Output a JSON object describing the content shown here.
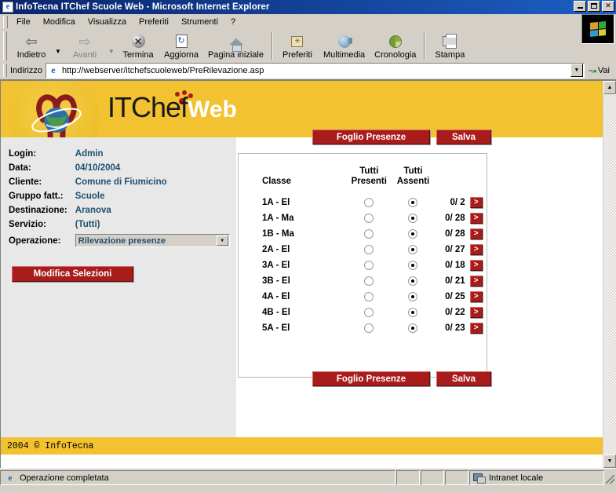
{
  "window": {
    "title": "InfoTecna ITChef Scuole Web - Microsoft Internet Explorer",
    "icon": "ie-document-icon",
    "minimize_label": "_",
    "maximize_label": "□",
    "close_label": "✕"
  },
  "menu": {
    "items": [
      {
        "label": "File"
      },
      {
        "label": "Modifica"
      },
      {
        "label": "Visualizza"
      },
      {
        "label": "Preferiti"
      },
      {
        "label": "Strumenti"
      },
      {
        "label": "?"
      }
    ]
  },
  "toolbar": {
    "buttons": [
      {
        "label": "Indietro",
        "icon": "back-arrow-icon",
        "glyph": "⇦",
        "disabled": false,
        "has_dropdown": true
      },
      {
        "label": "Avanti",
        "icon": "forward-arrow-icon",
        "glyph": "⇨",
        "disabled": true,
        "has_dropdown": true
      },
      {
        "label": "Termina",
        "icon": "stop-icon",
        "glyph": "✕",
        "disabled": false,
        "has_dropdown": false
      },
      {
        "label": "Aggiorna",
        "icon": "refresh-icon",
        "glyph": "↻",
        "disabled": false,
        "has_dropdown": false
      },
      {
        "label": "Pagina iniziale",
        "icon": "home-icon",
        "glyph": "",
        "disabled": false,
        "has_dropdown": false
      },
      {
        "label": "Preferiti",
        "icon": "favorites-icon",
        "glyph": "✳",
        "disabled": false,
        "has_dropdown": false
      },
      {
        "label": "Multimedia",
        "icon": "media-icon",
        "glyph": "",
        "disabled": false,
        "has_dropdown": false
      },
      {
        "label": "Cronologia",
        "icon": "history-icon",
        "glyph": "",
        "disabled": false,
        "has_dropdown": false
      },
      {
        "label": "Stampa",
        "icon": "print-icon",
        "glyph": "",
        "disabled": false,
        "has_dropdown": false
      }
    ]
  },
  "address_bar": {
    "label": "Indirizzo",
    "url": "http://webserver/itchefscuoleweb/PreRilevazione.asp",
    "go_label": "Vai",
    "icon": "ie-page-icon",
    "dropdown_icon": "chevron-down-icon"
  },
  "page": {
    "brand": {
      "text_dark": "ITChef",
      "text_light": "Web",
      "logo_icon": "globe-logo-icon"
    },
    "info": {
      "rows": [
        {
          "label": "Login:",
          "value": "Admin"
        },
        {
          "label": "Data:",
          "value": "04/10/2004"
        },
        {
          "label": "Cliente:",
          "value": "Comune di Fiumicino"
        },
        {
          "label": "Gruppo fatt.:",
          "value": "Scuole"
        },
        {
          "label": "Destinazione:",
          "value": "Aranova"
        },
        {
          "label": "Servizio:",
          "value": "(Tutti)"
        }
      ],
      "operation_label": "Operazione:",
      "operation_value": "Rilevazione presenze",
      "operation_options": [
        "Rilevazione presenze"
      ],
      "modify_button": "Modifica Selezioni"
    },
    "actions": {
      "sheet_button": "Foglio Presenze",
      "save_button": "Salva"
    },
    "table": {
      "headers": {
        "class": "Classe",
        "all_present": "Tutti\nPresenti",
        "all_present_line1": "Tutti",
        "all_present_line2": "Presenti",
        "all_absent_line1": "Tutti",
        "all_absent_line2": "Assenti"
      },
      "rows": [
        {
          "class": "1A - El",
          "all_present": false,
          "all_absent": true,
          "count": "0/ 2",
          "go": ">"
        },
        {
          "class": "1A - Ma",
          "all_present": false,
          "all_absent": true,
          "count": "0/ 28",
          "go": ">"
        },
        {
          "class": "1B - Ma",
          "all_present": false,
          "all_absent": true,
          "count": "0/ 28",
          "go": ">"
        },
        {
          "class": "2A - El",
          "all_present": false,
          "all_absent": true,
          "count": "0/ 27",
          "go": ">"
        },
        {
          "class": "3A - El",
          "all_present": false,
          "all_absent": true,
          "count": "0/ 18",
          "go": ">"
        },
        {
          "class": "3B - El",
          "all_present": false,
          "all_absent": true,
          "count": "0/ 21",
          "go": ">"
        },
        {
          "class": "4A - El",
          "all_present": false,
          "all_absent": true,
          "count": "0/ 25",
          "go": ">"
        },
        {
          "class": "4B - El",
          "all_present": false,
          "all_absent": true,
          "count": "0/ 22",
          "go": ">"
        },
        {
          "class": "5A - El",
          "all_present": false,
          "all_absent": true,
          "count": "0/ 23",
          "go": ">"
        }
      ]
    },
    "footer": "2004 © InfoTecna"
  },
  "status_bar": {
    "message": "Operazione completata",
    "zone": "Intranet locale",
    "zone_icon": "network-zone-icon"
  },
  "colors": {
    "brand_yellow": "#f2c230",
    "accent_red": "#a81c1c",
    "title_blue": "#0a246a",
    "info_value": "#1f4f6f",
    "chrome_gray": "#d4d0c8"
  }
}
